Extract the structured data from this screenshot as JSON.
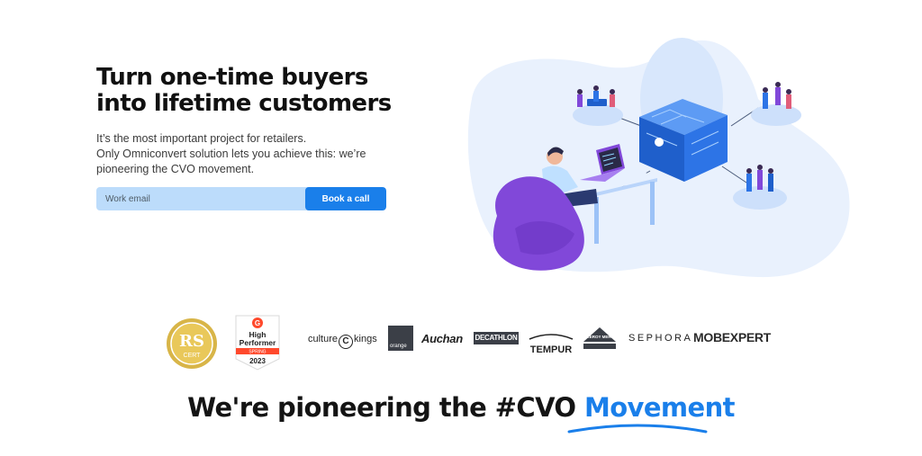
{
  "hero": {
    "title_line1": "Turn one-time buyers",
    "title_line2": "into lifetime customers",
    "subtitle_line1": "It’s the most important project for retailers.",
    "subtitle_line2": "Only Omniconvert solution lets you achieve this: we’re",
    "subtitle_line3": "pioneering the CVO movement."
  },
  "signup": {
    "email_placeholder": "Work email",
    "button_label": "Book a call"
  },
  "badges": {
    "rs": {
      "mark": "RS",
      "sub": "CERT"
    },
    "g2": {
      "logo": "G",
      "line1": "High",
      "line2": "Performer",
      "season": "SPRING",
      "year": "2023"
    }
  },
  "logos": {
    "culture_kings_a": "culture",
    "culture_kings_c": "C",
    "culture_kings_b": "kings",
    "orange": "orange",
    "auchan": "Auchan",
    "decathlon": "DECATHLON",
    "tempur": "TEMPUR",
    "leroy_merlin": "LEROY MERLIN",
    "sephora": "SEPHORA",
    "mobexpert": "MOBEXPERT"
  },
  "bottom": {
    "title_prefix": "We're pioneering the #CVO ",
    "title_accent": "Movement"
  },
  "colors": {
    "accent": "#1a7fea",
    "input_bg": "#bcdcfb",
    "blob": "#e9f1fd",
    "server": "#2469d6",
    "chair": "#8148d9"
  }
}
